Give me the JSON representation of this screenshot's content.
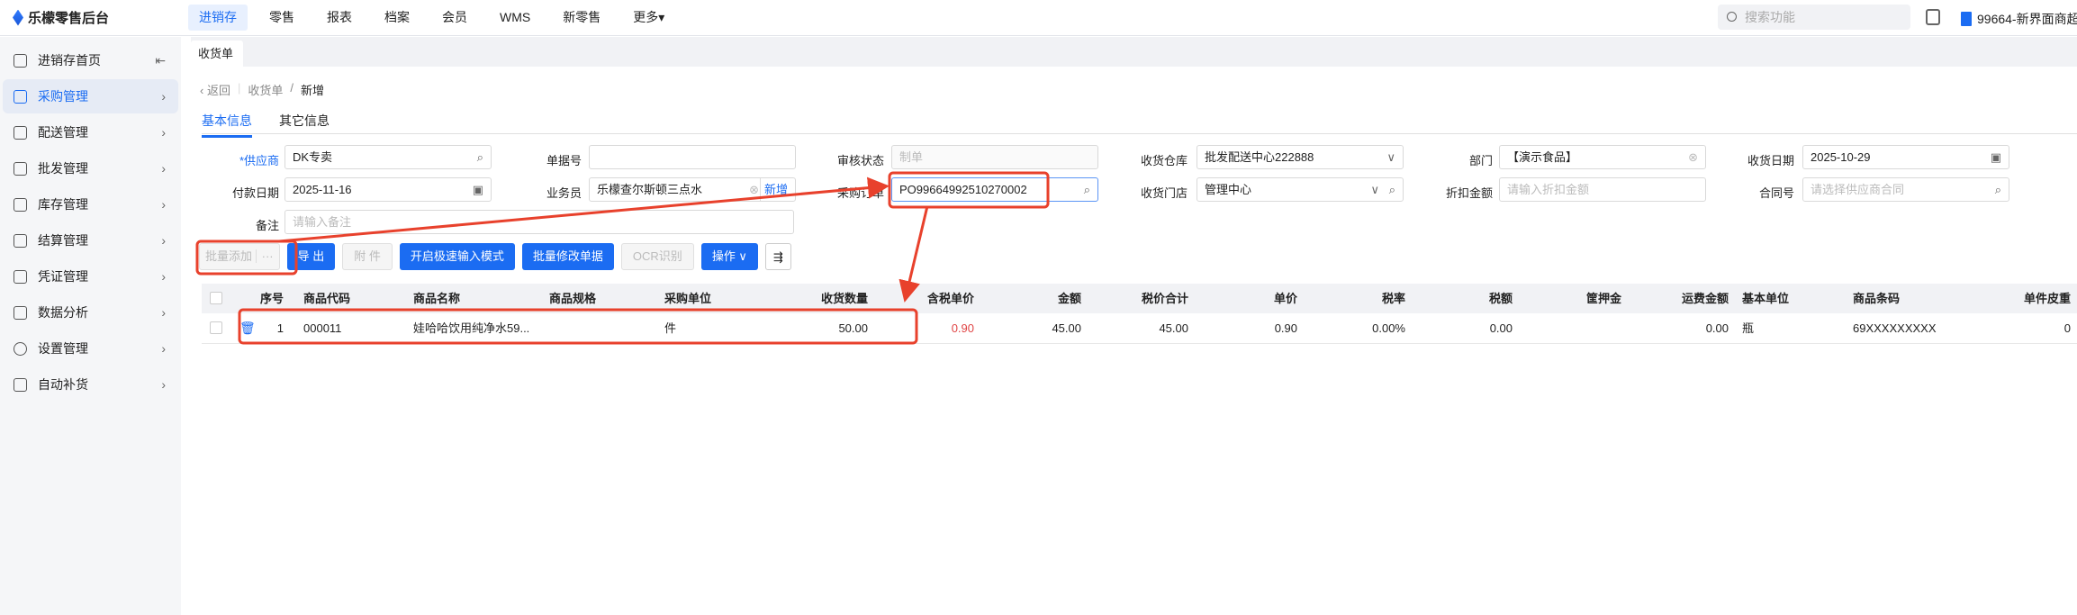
{
  "app": {
    "title": "乐檬零售后台"
  },
  "nav": [
    "进销存",
    "零售",
    "报表",
    "档案",
    "会员",
    "WMS",
    "新零售",
    "更多▾"
  ],
  "search": {
    "placeholder": "搜索功能"
  },
  "store": "99664-新界面商超",
  "sidebar": {
    "collapse": "⇤",
    "items": [
      "进销存首页",
      "采购管理",
      "配送管理",
      "批发管理",
      "库存管理",
      "结算管理",
      "凭证管理",
      "数据分析",
      "设置管理",
      "自动补货"
    ]
  },
  "tab": "收货单",
  "breadcrumb": {
    "back": "返回",
    "parent": "收货单",
    "current": "新增"
  },
  "inner_tabs": [
    "基本信息",
    "其它信息"
  ],
  "form": {
    "supplier": {
      "label": "*供应商",
      "value": "DK专卖"
    },
    "doc_no": {
      "label": "单据号",
      "value": ""
    },
    "audit": {
      "label": "审核状态",
      "placeholder": "制单"
    },
    "warehouse": {
      "label": "收货仓库",
      "value": "批发配送中心222888"
    },
    "dept": {
      "label": "部门",
      "value": "【演示食品】"
    },
    "recv_date": {
      "label": "收货日期",
      "value": "2025-10-29"
    },
    "pay_date": {
      "label": "付款日期",
      "value": "2025-11-16"
    },
    "salesman": {
      "label": "业务员",
      "value": "乐檬查尔斯顿三点水",
      "add": "新增"
    },
    "po": {
      "label": "采购订单",
      "value": "PO99664992510270002"
    },
    "store": {
      "label": "收货门店",
      "value": "管理中心"
    },
    "discount": {
      "label": "折扣金额",
      "placeholder": "请输入折扣金额"
    },
    "contract": {
      "label": "合同号",
      "placeholder": "请选择供应商合同"
    },
    "remark": {
      "label": "备注",
      "placeholder": "请输入备注"
    }
  },
  "toolbar": {
    "batch_add": "批量添加",
    "more": "···",
    "export": "导 出",
    "attach": "附 件",
    "fast": "开启极速输入模式",
    "batch_edit": "批量修改单据",
    "ocr": "OCR识别",
    "ops": "操作 ∨",
    "cols": "⇶"
  },
  "table": {
    "headers": [
      "序号",
      "商品代码",
      "商品名称",
      "商品规格",
      "采购单位",
      "收货数量",
      "含税单价",
      "金额",
      "税价合计",
      "单价",
      "税率",
      "税额",
      "筐押金",
      "运费金额",
      "基本单位",
      "商品条码",
      "单件皮重"
    ],
    "rows": [
      [
        "1",
        "000011",
        "娃哈哈饮用纯净水59...",
        "",
        "件",
        "50.00",
        "0.90",
        "45.00",
        "45.00",
        "0.90",
        "0.00%",
        "0.00",
        "",
        "0.00",
        "瓶",
        "69XXXXXXXXX",
        "0"
      ]
    ]
  },
  "colors": {
    "accent": "#1b6cf2",
    "annotation": "#e8412c",
    "price": "#e04545"
  }
}
